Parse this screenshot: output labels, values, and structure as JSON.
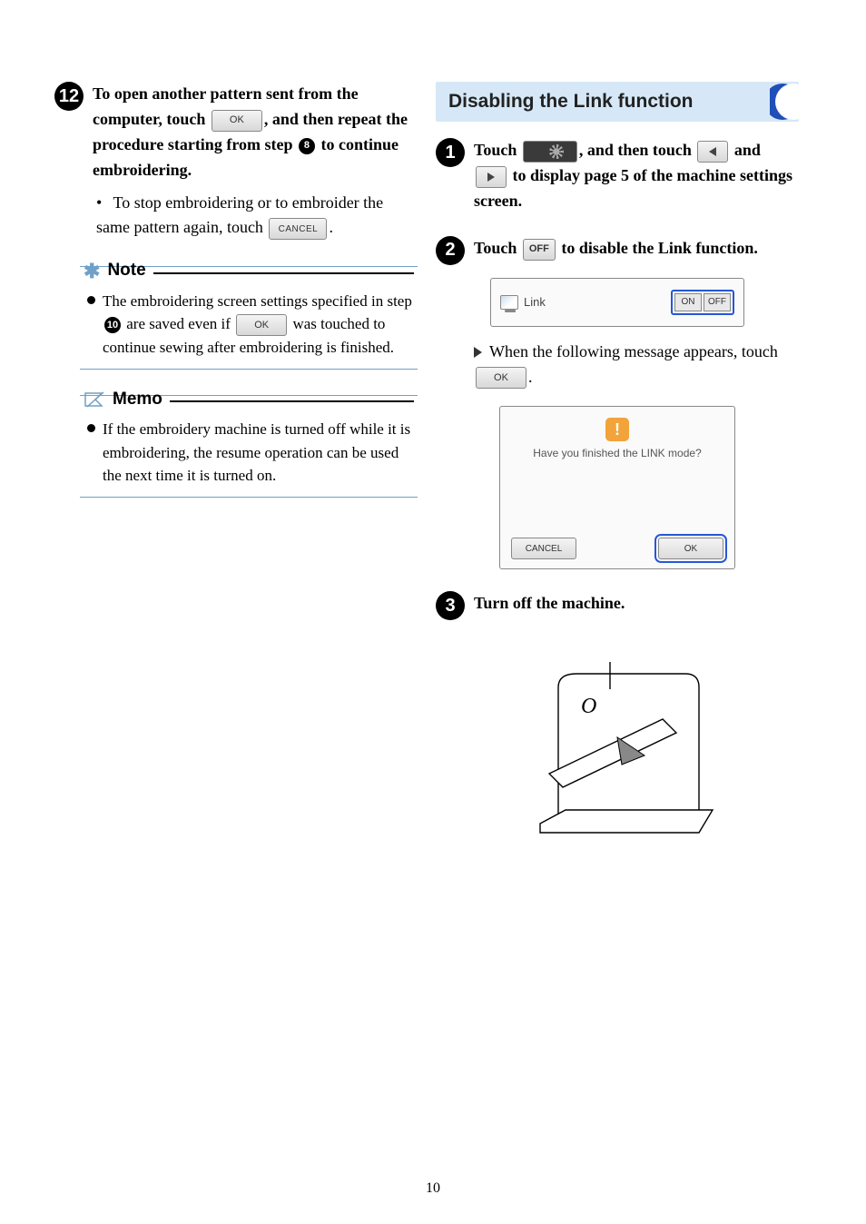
{
  "left": {
    "step12": {
      "badge": "12",
      "text_a": "To open another pattern sent from the computer, touch",
      "ok_label": "OK",
      "text_b": ", and then repeat the procedure starting from step",
      "ref_badge": "8",
      "text_c": "to continue embroidering.",
      "bullet_a": "To stop embroidering or to embroider the same pattern again, touch",
      "cancel_label": "CANCEL",
      "bullet_b": "."
    },
    "note": {
      "head": "Note",
      "body_a": "The embroidering screen settings specified in step",
      "ref_badge": "10",
      "body_b": "are saved even if",
      "ok_label": "OK",
      "body_c": "was touched to continue sewing after embroidering is finished."
    },
    "memo": {
      "head": "Memo",
      "body": "If the embroidery machine is turned off while it is embroidering, the resume operation can be used the next time it is turned on."
    }
  },
  "right": {
    "section_title": "Disabling the Link function",
    "step1": {
      "badge": "1",
      "text_a": "Touch",
      "text_b": ", and then touch",
      "text_c": "and",
      "text_d": "to display page 5 of the machine settings screen."
    },
    "step2": {
      "badge": "2",
      "text_a": "Touch",
      "off_label": "OFF",
      "text_b": "to disable the Link function.",
      "panel": {
        "link_label": "Link",
        "on_label": "ON",
        "off_label": "OFF"
      },
      "result_a": "When the following message appears, touch",
      "ok_label": "OK",
      "result_b": ".",
      "dialog": {
        "msg": "Have you finished the LINK mode?",
        "cancel": "CANCEL",
        "ok": "OK"
      }
    },
    "step3": {
      "badge": "3",
      "text": "Turn off the machine."
    },
    "illus_label": "O"
  },
  "page_no": "10"
}
